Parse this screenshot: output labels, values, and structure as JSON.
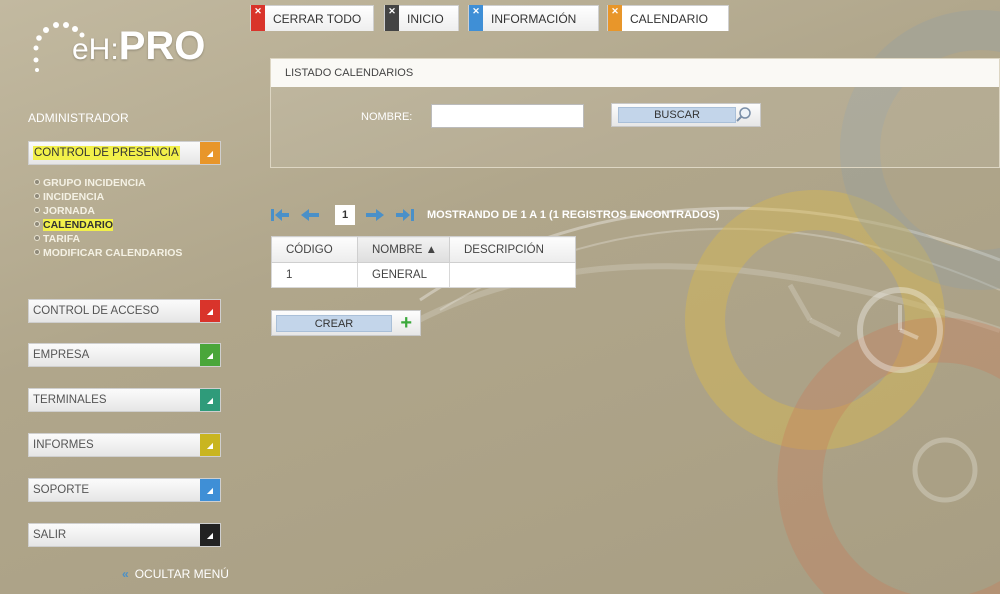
{
  "logo": {
    "prefix": "eH:",
    "brand": "PRO"
  },
  "sidebar": {
    "role": "ADMINISTRADOR",
    "sections": [
      {
        "label": "CONTROL DE PRESENCIA",
        "color": "#e8962a",
        "active": true
      },
      {
        "label": "CONTROL DE ACCESO",
        "color": "#d9342b"
      },
      {
        "label": "EMPRESA",
        "color": "#4aa63a"
      },
      {
        "label": "TERMINALES",
        "color": "#2f9b7a"
      },
      {
        "label": "INFORMES",
        "color": "#c9b520"
      },
      {
        "label": "SOPORTE",
        "color": "#3f8fd6"
      },
      {
        "label": "SALIR",
        "color": "#222222"
      }
    ],
    "submenu": [
      "GRUPO INCIDENCIA",
      "INCIDENCIA",
      "JORNADA",
      "CALENDARIO",
      "TARIFA",
      "MODIFICAR CALENDARIOS"
    ],
    "current_submenu": "CALENDARIO",
    "hide_menu": "OCULTAR MENÚ"
  },
  "tabs": [
    {
      "label": "CERRAR TODO",
      "x_color": "#d9342b"
    },
    {
      "label": "INICIO",
      "x_color": "#444444"
    },
    {
      "label": "INFORMACIÓN",
      "x_color": "#3f8fd6"
    },
    {
      "label": "CALENDARIO",
      "x_color": "#e8962a",
      "active": true
    }
  ],
  "panel": {
    "title": "LISTADO CALENDARIOS",
    "nombre_label": "NOMBRE:",
    "nombre_value": "",
    "search_label": "BUSCAR"
  },
  "pager": {
    "page": "1",
    "info": "MOSTRANDO DE 1 A 1 (1 REGISTROS ENCONTRADOS)"
  },
  "table": {
    "headers": [
      "CÓDIGO",
      "NOMBRE ▲",
      "DESCRIPCIÓN"
    ],
    "rows": [
      [
        "1",
        "GENERAL",
        ""
      ]
    ]
  },
  "create_label": "CREAR",
  "colors": {
    "highlight": "#f2f04a",
    "button_inner": "#c3d5ea",
    "accent_blue": "#4a90c8"
  }
}
